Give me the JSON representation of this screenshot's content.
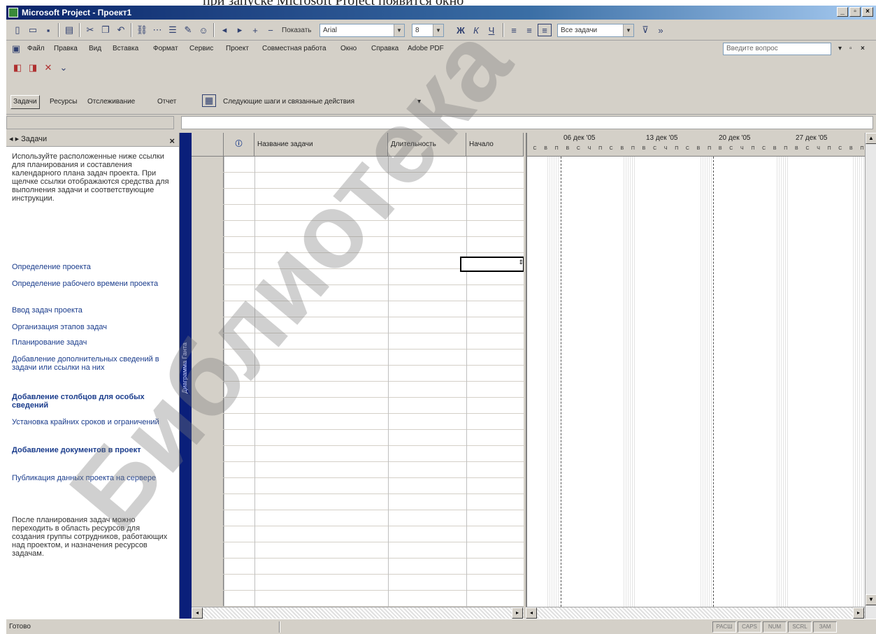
{
  "caption": "при запуске Microsoft Project появится окно",
  "window": {
    "title": "Microsoft Project - Проект1",
    "min": "_",
    "max": "▫",
    "close": "×"
  },
  "toolbar1": {
    "grouping_value": "Все задачи",
    "font_name": "Arial",
    "font_size": "8",
    "bold": "Ж",
    "italic": "К",
    "underline": "Ч",
    "all_tasks_value": "Все задачи",
    "show_label": "Показать"
  },
  "menu": {
    "items": [
      "Файл",
      "Правка",
      "Вид",
      "Вставка",
      "Формат",
      "Сервис",
      "Проект",
      "Совместная работа",
      "Окно",
      "Справка",
      "Adobe PDF"
    ],
    "help_placeholder": "Введите вопрос"
  },
  "guide": {
    "tasks_btn": "Задачи",
    "items": [
      "Ресурсы",
      "Отслеживание",
      "Отчет"
    ],
    "next_steps": "Следующие шаги и связанные действия"
  },
  "taskpane": {
    "title": "Задачи",
    "close": "×",
    "intro": "Используйте расположенные ниже ссылки для планирования и составления календарного плана задач проекта. При щелчке ссылки отображаются средства для выполнения задачи и соответствующие инструкции.",
    "links": [
      {
        "text": "Определение проекта",
        "bold": false
      },
      {
        "text": "Определение рабочего времени проекта",
        "bold": false
      },
      {
        "text": "Ввод задач проекта",
        "bold": false
      },
      {
        "text": "Организация этапов задач",
        "bold": false
      },
      {
        "text": "Планирование задач",
        "bold": false
      },
      {
        "text": "Добавление дополнительных сведений в задачи или ссылки на них",
        "bold": false
      },
      {
        "text": "Добавление столбцов для особых сведений",
        "bold": true
      },
      {
        "text": "Установка крайних сроков и ограничений",
        "bold": false
      },
      {
        "text": "Добавление документов в проект",
        "bold": true
      },
      {
        "text": "Публикация данных проекта на сервере",
        "bold": false
      }
    ],
    "outro": "После планирования задач можно переходить в область ресурсов для создания группы сотрудников, работающих над проектом, и назначения ресурсов задачам."
  },
  "viewbar": {
    "label": "Диаграмма Ганта"
  },
  "sheet": {
    "columns": {
      "indicator": "ⓘ",
      "name": "Название задачи",
      "duration": "Длительность",
      "start": "Начало"
    }
  },
  "gantt": {
    "weeks": [
      "06 дек '05",
      "13 дек '05",
      "20 дек '05",
      "27 дек '05"
    ],
    "days": [
      "П",
      "В",
      "С",
      "Ч",
      "П",
      "С",
      "В"
    ]
  },
  "status": {
    "text": "Готово",
    "indicators": [
      "РАСШ",
      "CAPS",
      "NUM",
      "SCRL",
      "ЗАМ"
    ]
  }
}
